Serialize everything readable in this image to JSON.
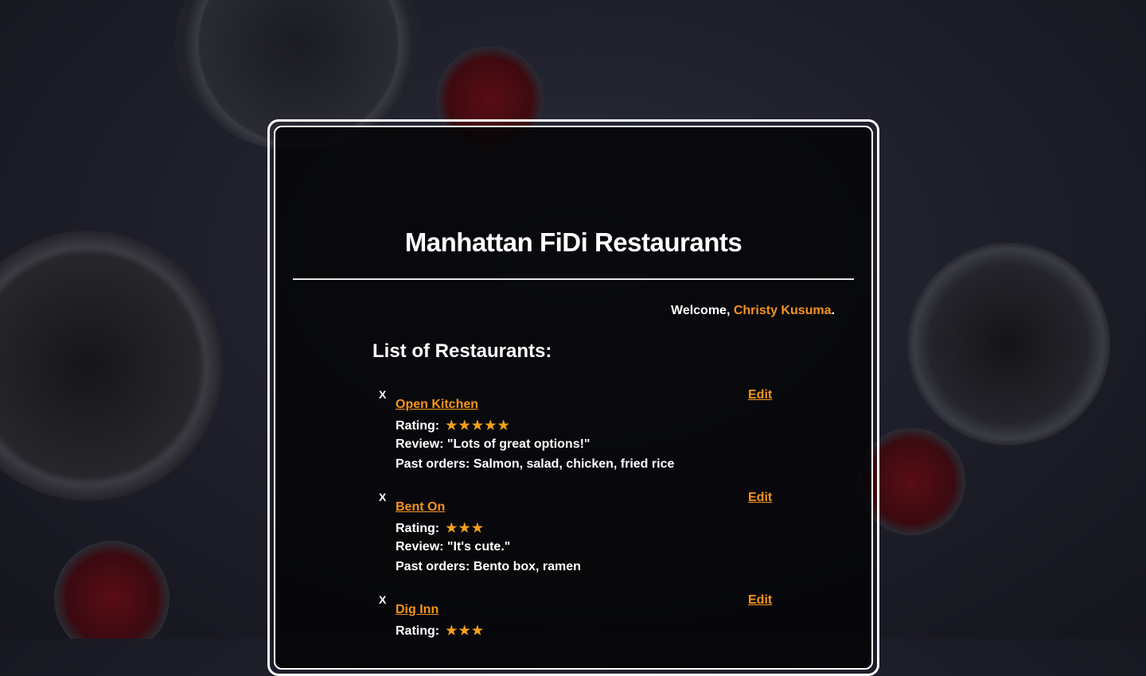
{
  "page": {
    "title": "Manhattan FiDi Restaurants",
    "welcome_prefix": "Welcome, ",
    "user_name": "Christy Kusuma",
    "welcome_suffix": ".",
    "list_heading": "List of Restaurants:"
  },
  "colors": {
    "accent": "#f7941d",
    "text": "#ffffff",
    "panel_bg": "#050507"
  },
  "restaurants": [
    {
      "delete_label": "X",
      "name": "Open Kitchen",
      "rating_label": "Rating:",
      "rating": 5,
      "stars": "★★★★★",
      "review": "Review: \"Lots of great options!\"",
      "past_orders": "Past orders: Salmon, salad, chicken, fried rice",
      "edit_label": "Edit"
    },
    {
      "delete_label": "X",
      "name": "Bent On",
      "rating_label": "Rating:",
      "rating": 3,
      "stars": "★★★",
      "review": "Review: \"It's cute.\"",
      "past_orders": "Past orders: Bento box, ramen",
      "edit_label": "Edit"
    },
    {
      "delete_label": "X",
      "name": "Dig Inn",
      "rating_label": "Rating:",
      "rating": 3,
      "stars": "★★★",
      "edit_label": "Edit"
    }
  ],
  "icons": {
    "delete": "x-icon",
    "star": "star-icon"
  }
}
